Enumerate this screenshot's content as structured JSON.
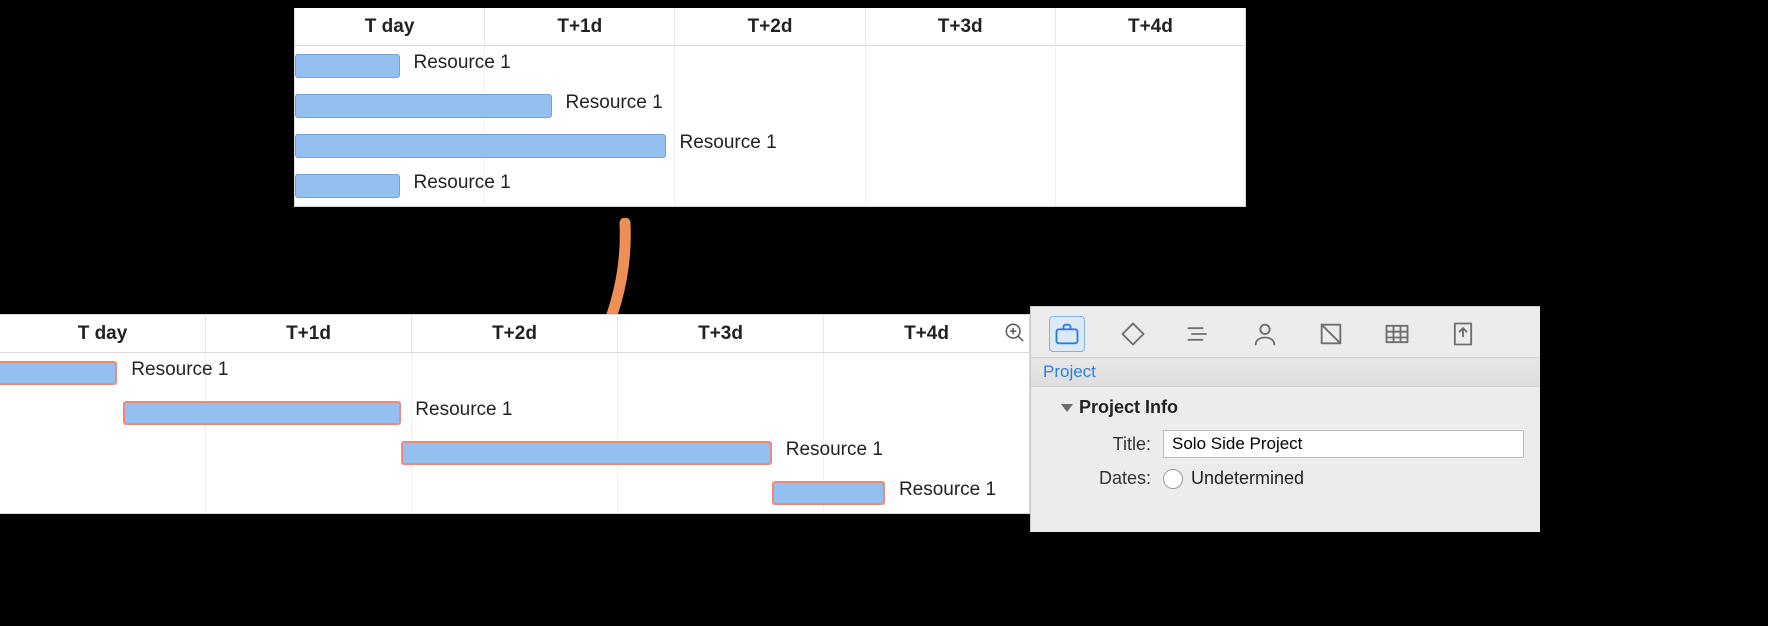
{
  "timeline": {
    "columns": [
      "T day",
      "T+1d",
      "T+2d",
      "T+3d",
      "T+4d"
    ]
  },
  "top_gantt": {
    "rows": [
      {
        "label": "Resource 1",
        "start_col": 0,
        "span_cols": 0.55
      },
      {
        "label": "Resource 1",
        "start_col": 0,
        "span_cols": 1.35
      },
      {
        "label": "Resource 1",
        "start_col": 0,
        "span_cols": 1.95
      },
      {
        "label": "Resource 1",
        "start_col": 0,
        "span_cols": 0.55
      }
    ]
  },
  "bottom_gantt": {
    "rows": [
      {
        "label": "Resource 1",
        "start_col": -0.05,
        "span_cols": 0.62,
        "selected": true
      },
      {
        "label": "Resource 1",
        "start_col": 0.6,
        "span_cols": 1.35,
        "selected": true
      },
      {
        "label": "Resource 1",
        "start_col": 1.95,
        "span_cols": 1.8,
        "selected": true
      },
      {
        "label": "Resource 1",
        "start_col": 3.75,
        "span_cols": 0.55,
        "selected": true
      }
    ]
  },
  "zoom_icon": "zoom-in",
  "inspector": {
    "tabs": [
      {
        "id": "project",
        "icon": "briefcase",
        "active": true
      },
      {
        "id": "milestone",
        "icon": "diamond",
        "active": false
      },
      {
        "id": "task",
        "icon": "bars",
        "active": false
      },
      {
        "id": "resource",
        "icon": "person",
        "active": false
      },
      {
        "id": "styles",
        "icon": "swatch",
        "active": false
      },
      {
        "id": "columns",
        "icon": "table",
        "active": false
      },
      {
        "id": "export",
        "icon": "share",
        "active": false
      }
    ],
    "subhead": "Project",
    "section_title": "Project Info",
    "title_label": "Title:",
    "title_value": "Solo Side Project",
    "dates_label": "Dates:",
    "dates_option_undetermined": "Undetermined"
  }
}
